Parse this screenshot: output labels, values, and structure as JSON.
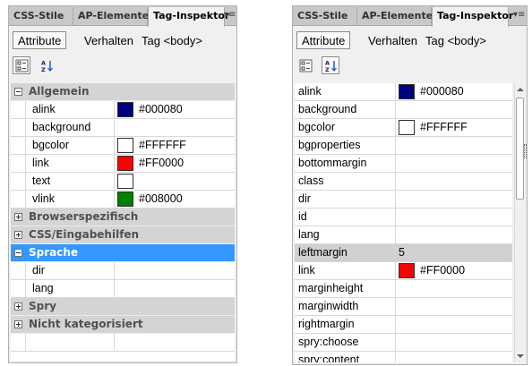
{
  "left_panel": {
    "tabs": [
      {
        "label": "CSS-Stile"
      },
      {
        "label": "AP-Elemente"
      },
      {
        "label": "Tag-Inspektor"
      }
    ],
    "subtabs": [
      {
        "label": "Attribute"
      },
      {
        "label": "Verhalten"
      }
    ],
    "tag_label": "Tag <body>",
    "toolbar_icons": [
      "category-view-icon",
      "sort-alphabetical-icon"
    ],
    "selected_icon": "category-view-icon",
    "rows": [
      {
        "type": "category",
        "label": "Allgemein",
        "expanded": true
      },
      {
        "type": "property",
        "name": "alink",
        "color": "#000080",
        "value": "#000080"
      },
      {
        "type": "property",
        "name": "background"
      },
      {
        "type": "property",
        "name": "bgcolor",
        "color": "#FFFFFF",
        "value": "#FFFFFF"
      },
      {
        "type": "property",
        "name": "link",
        "color": "#FF0000",
        "value": "#FF0000"
      },
      {
        "type": "property",
        "name": "text",
        "color": "#FFFFFF",
        "value": ""
      },
      {
        "type": "property",
        "name": "vlink",
        "color": "#008000",
        "value": "#008000"
      },
      {
        "type": "category",
        "label": "Browserspezifisch",
        "expanded": false
      },
      {
        "type": "category",
        "label": "CSS/Eingabehilfen",
        "expanded": false
      },
      {
        "type": "category",
        "label": "Sprache",
        "expanded": true,
        "selected": true
      },
      {
        "type": "property",
        "name": "dir"
      },
      {
        "type": "property",
        "name": "lang"
      },
      {
        "type": "category",
        "label": "Spry",
        "expanded": false
      },
      {
        "type": "category",
        "label": "Nicht kategorisiert",
        "expanded": false
      },
      {
        "type": "blank"
      }
    ]
  },
  "right_panel": {
    "tabs": [
      {
        "label": "CSS-Stile"
      },
      {
        "label": "AP-Elemente"
      },
      {
        "label": "Tag-Inspektor"
      }
    ],
    "subtabs": [
      {
        "label": "Attribute"
      },
      {
        "label": "Verhalten"
      }
    ],
    "tag_label": "Tag <body>",
    "toolbar_icons": [
      "category-view-icon",
      "sort-alphabetical-icon"
    ],
    "selected_icon": "sort-alphabetical-icon",
    "rows": [
      {
        "type": "property",
        "name": "alink",
        "color": "#000080",
        "value": "#000080"
      },
      {
        "type": "property",
        "name": "background"
      },
      {
        "type": "property",
        "name": "bgcolor",
        "color": "#FFFFFF",
        "value": "#FFFFFF"
      },
      {
        "type": "property",
        "name": "bgproperties"
      },
      {
        "type": "property",
        "name": "bottommargin"
      },
      {
        "type": "property",
        "name": "class"
      },
      {
        "type": "property",
        "name": "dir"
      },
      {
        "type": "property",
        "name": "id"
      },
      {
        "type": "property",
        "name": "lang"
      },
      {
        "type": "property",
        "name": "leftmargin",
        "value": "5",
        "highlight": true
      },
      {
        "type": "property",
        "name": "link",
        "color": "#FF0000",
        "value": "#FF0000"
      },
      {
        "type": "property",
        "name": "marginheight"
      },
      {
        "type": "property",
        "name": "marginwidth"
      },
      {
        "type": "property",
        "name": "rightmargin"
      },
      {
        "type": "property",
        "name": "spry:choose"
      },
      {
        "type": "property",
        "name": "spry:content"
      }
    ]
  },
  "colors": {
    "selected_category": "#3399ff",
    "category_background": "#d4d4d4",
    "panel_background": "#f0f0f0"
  }
}
